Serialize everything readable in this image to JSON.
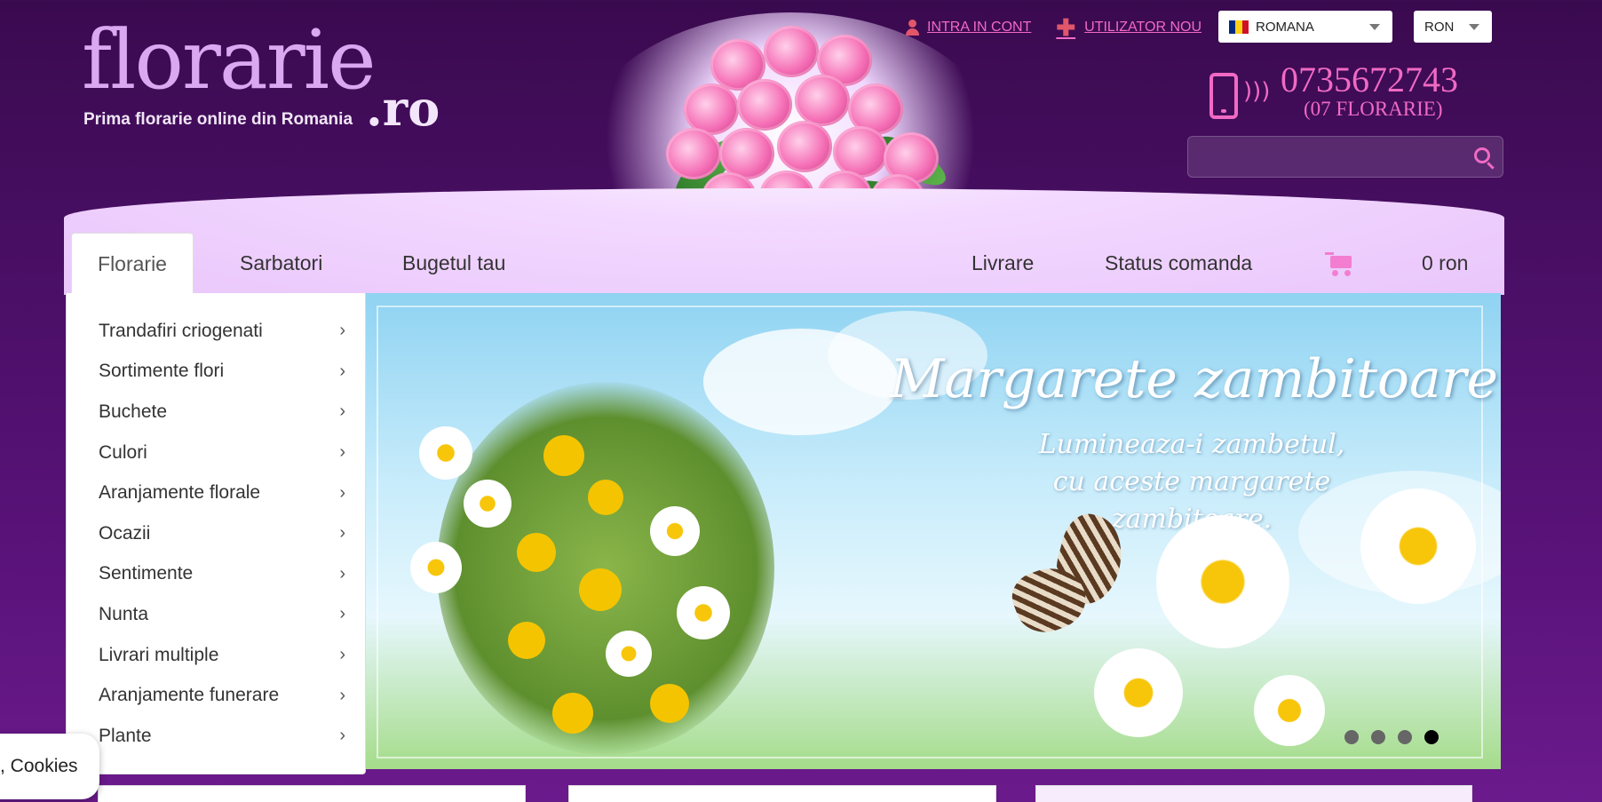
{
  "header": {
    "logo_text": "florarie",
    "logo_suffix": ".ro",
    "tagline": "Prima florarie online din Romania",
    "login_label": "INTRA IN CONT",
    "register_label": "UTILIZATOR NOU",
    "language": "ROMANA",
    "currency": "RON",
    "phone": "0735672743",
    "phone_alias": "(07 FLORARIE)",
    "search_placeholder": ""
  },
  "nav": {
    "tabs": [
      {
        "label": "Florarie",
        "active": true
      },
      {
        "label": "Sarbatori"
      },
      {
        "label": "Bugetul tau"
      },
      {
        "label": "Livrare"
      },
      {
        "label": "Status comanda"
      }
    ],
    "cart_total": "0 ron"
  },
  "menu": {
    "items": [
      {
        "label": "Trandafiri criogenati"
      },
      {
        "label": "Sortimente flori"
      },
      {
        "label": "Buchete"
      },
      {
        "label": "Culori"
      },
      {
        "label": "Aranjamente florale"
      },
      {
        "label": "Ocazii"
      },
      {
        "label": "Sentimente"
      },
      {
        "label": "Nunta"
      },
      {
        "label": "Livrari multiple"
      },
      {
        "label": "Aranjamente funerare"
      },
      {
        "label": "Plante"
      }
    ]
  },
  "banner": {
    "title": "Margarete zambitoare",
    "subtitle_line1": "Lumineaza-i zambetul,",
    "subtitle_line2": "cu aceste margarete zambitoare.",
    "slides": 4,
    "active_slide": 4
  },
  "cookies": {
    "label": ", Cookies"
  },
  "colors": {
    "accent": "#f06ac4",
    "bg": "#4a0f66"
  }
}
